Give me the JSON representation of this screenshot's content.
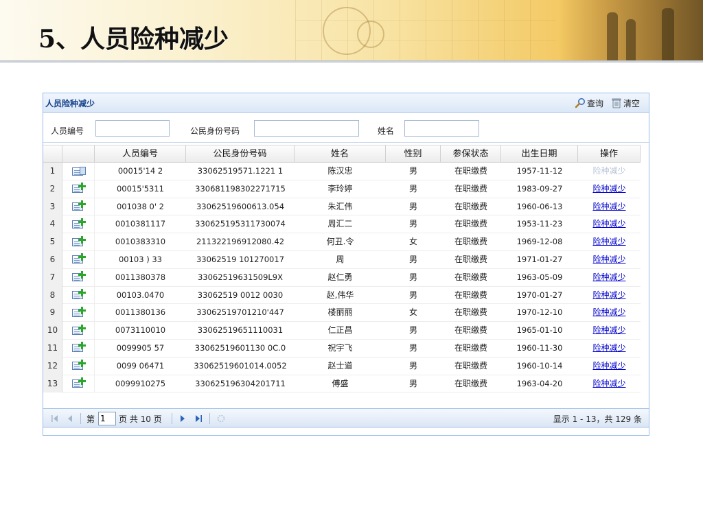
{
  "slide": {
    "title": "5、人员险种减少"
  },
  "panel": {
    "title": "人员险种减少",
    "toolbar": {
      "query_label": "查询",
      "clear_label": "清空"
    },
    "search": {
      "person_no_label": "人员编号",
      "person_no_value": "",
      "id_no_label": "公民身份号码",
      "id_no_value": "",
      "name_label": "姓名",
      "name_value": ""
    }
  },
  "grid": {
    "columns": [
      "人员编号",
      "公民身份号码",
      "姓名",
      "性别",
      "参保状态",
      "出生日期",
      "操作"
    ],
    "rows": [
      {
        "n": "1",
        "icon": "doc-minus",
        "no": "00015'14 2",
        "id": "33062519571.1221 1",
        "name": "陈汉忠",
        "sex": "男",
        "status": "在职缴费",
        "birth": "1957-11-12",
        "action": "险种减少",
        "enabled": false
      },
      {
        "n": "2",
        "icon": "doc-plus",
        "no": "00015'5311",
        "id": "330681198302271715",
        "name": "李玲婷",
        "sex": "男",
        "status": "在职缴费",
        "birth": "1983-09-27",
        "action": "险种减少",
        "enabled": true
      },
      {
        "n": "3",
        "icon": "doc-plus",
        "no": "001038 0' 2",
        "id": "33062519600613.054",
        "name": "朱汇伟",
        "sex": "男",
        "status": "在职缴费",
        "birth": "1960-06-13",
        "action": "险种减少",
        "enabled": true
      },
      {
        "n": "4",
        "icon": "doc-plus",
        "no": "0010381117",
        "id": "330625195311730074",
        "name": "周汇二",
        "sex": "男",
        "status": "在职缴费",
        "birth": "1953-11-23",
        "action": "险种减少",
        "enabled": true
      },
      {
        "n": "5",
        "icon": "doc-plus",
        "no": "0010383310",
        "id": "211322196912080.42",
        "name": "何丑.令",
        "sex": "女",
        "status": "在职缴费",
        "birth": "1969-12-08",
        "action": "险种减少",
        "enabled": true
      },
      {
        "n": "6",
        "icon": "doc-plus",
        "no": "00103 ) 33",
        "id": "33062519 101270017",
        "name": "周",
        "sex": "男",
        "status": "在职缴费",
        "birth": "1971-01-27",
        "action": "险种减少",
        "enabled": true
      },
      {
        "n": "7",
        "icon": "doc-plus",
        "no": "0011380378",
        "id": "33062519631509L9X",
        "name": "赵仁勇",
        "sex": "男",
        "status": "在职缴费",
        "birth": "1963-05-09",
        "action": "险种减少",
        "enabled": true
      },
      {
        "n": "8",
        "icon": "doc-plus",
        "no": "00103.0470",
        "id": "33062519 0012 0030",
        "name": "赵,伟华",
        "sex": "男",
        "status": "在职缴费",
        "birth": "1970-01-27",
        "action": "险种减少",
        "enabled": true
      },
      {
        "n": "9",
        "icon": "doc-plus",
        "no": "0011380136",
        "id": "33062519701210'447",
        "name": "楼丽丽",
        "sex": "女",
        "status": "在职缴费",
        "birth": "1970-12-10",
        "action": "险种减少",
        "enabled": true
      },
      {
        "n": "10",
        "icon": "doc-plus",
        "no": "0073110010",
        "id": "33062519651110031",
        "name": "仁正昌",
        "sex": "男",
        "status": "在职缴费",
        "birth": "1965-01-10",
        "action": "险种减少",
        "enabled": true
      },
      {
        "n": "11",
        "icon": "doc-plus",
        "no": "0099905 57",
        "id": "33062519601130 0C.0",
        "name": "祝宇飞",
        "sex": "男",
        "status": "在职缴费",
        "birth": "1960-11-30",
        "action": "险种减少",
        "enabled": true
      },
      {
        "n": "12",
        "icon": "doc-plus",
        "no": "0099 06471",
        "id": "33062519601014.0052",
        "name": "赵士道",
        "sex": "男",
        "status": "在职缴费",
        "birth": "1960-10-14",
        "action": "险种减少",
        "enabled": true
      },
      {
        "n": "13",
        "icon": "doc-plus",
        "no": "0099910275",
        "id": "330625196304201711",
        "name": "傅盛",
        "sex": "男",
        "status": "在职缴费",
        "birth": "1963-04-20",
        "action": "险种减少",
        "enabled": true
      }
    ]
  },
  "paging": {
    "page_prefix": "第",
    "page_value": "1",
    "page_suffix": "页 共 10 页",
    "display_info": "显示 1 - 13，共 129 条"
  },
  "colors": {
    "panel_border": "#99bbe8",
    "panel_title": "#15428b",
    "link": "#0000cc",
    "link_disabled": "#b8c4d6",
    "plus_green": "#2aa628"
  }
}
